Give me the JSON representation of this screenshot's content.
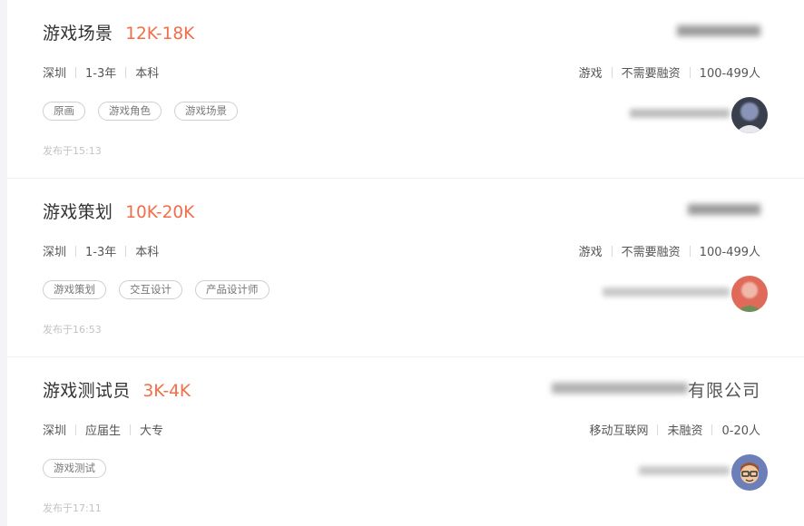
{
  "jobs": [
    {
      "title": "游戏场景",
      "salary": "12K-18K",
      "location": "深圳",
      "experience": "1-3年",
      "education": "本科",
      "tags": [
        "原画",
        "游戏角色",
        "游戏场景"
      ],
      "publish_time": "发布于15:13",
      "company_name": "",
      "industry": "游戏",
      "funding": "不需要融资",
      "size": "100-499人",
      "recruiter": "",
      "avatar_icon": "person-photo-avatar"
    },
    {
      "title": "游戏策划",
      "salary": "10K-20K",
      "location": "深圳",
      "experience": "1-3年",
      "education": "本科",
      "tags": [
        "游戏策划",
        "交互设计",
        "产品设计师"
      ],
      "publish_time": "发布于16:53",
      "company_name": "",
      "industry": "游戏",
      "funding": "不需要融资",
      "size": "100-499人",
      "recruiter": "",
      "avatar_icon": "red-avatar"
    },
    {
      "title": "游戏测试员",
      "salary": "3K-4K",
      "location": "深圳",
      "experience": "应届生",
      "education": "大专",
      "tags": [
        "游戏测试"
      ],
      "publish_time": "发布于17:11",
      "company_name_visible": "有限公司",
      "industry": "移动互联网",
      "funding": "未融资",
      "size": "0-20人",
      "recruiter": "",
      "avatar_icon": "cartoon-glasses-avatar"
    }
  ],
  "colors": {
    "salary": "#f26d49",
    "title": "#333333",
    "text": "#555555",
    "tag_border": "#cfcfcf",
    "publish": "#c3c3c3"
  }
}
